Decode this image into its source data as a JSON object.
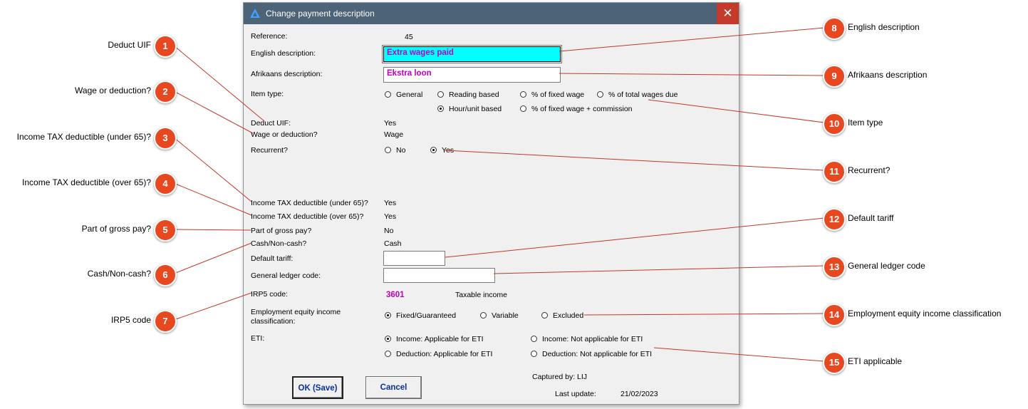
{
  "dialog": {
    "title": "Change payment description",
    "close_glyph": "✕",
    "fields": {
      "reference_label": "Reference:",
      "reference_value": "45",
      "english_label": "English description:",
      "english_value": "Extra wages paid",
      "afrikaans_label": "Afrikaans description:",
      "afrikaans_value": "Ekstra loon",
      "item_type_label": "Item type:",
      "item_type_options": [
        "General",
        "Reading based",
        "% of fixed wage",
        "% of total wages due",
        "Hour/unit based",
        "% of fixed wage + commission"
      ],
      "item_type_selected": "Hour/unit based",
      "deduct_uif_label": "Deduct UIF:",
      "deduct_uif_value": "Yes",
      "wage_deduction_label": "Wage or deduction?",
      "wage_deduction_value": "Wage",
      "recurrent_label": "Recurrent?",
      "recurrent_options": [
        "No",
        "Yes"
      ],
      "recurrent_selected": "Yes",
      "tax_under_label": "Income TAX deductible (under 65)?",
      "tax_under_value": "Yes",
      "tax_over_label": "Income TAX deductible (over 65)?",
      "tax_over_value": "Yes",
      "gross_label": "Part of gross pay?",
      "gross_value": "No",
      "cash_label": "Cash/Non-cash?",
      "cash_value": "Cash",
      "tariff_label": "Default tariff:",
      "tariff_value": "",
      "gl_label": "General ledger code:",
      "gl_value": "",
      "irp5_label": "IRP5 code:",
      "irp5_value": "3601",
      "irp5_desc": "Taxable income",
      "ee_label_1": "Employment equity income",
      "ee_label_2": "classification:",
      "ee_options": [
        "Fixed/Guaranteed",
        "Variable",
        "Excluded"
      ],
      "ee_selected": "Fixed/Guaranteed",
      "eti_label": "ETI:",
      "eti_options": [
        "Income: Applicable for ETI",
        "Income: Not applicable for ETI",
        "Deduction: Applicable for ETI",
        "Deduction: Not applicable for ETI"
      ],
      "eti_selected": "Income: Applicable for ETI",
      "captured_by": "Captured by: LIJ",
      "last_update_label": "Last update:",
      "last_update_value": "21/02/2023"
    },
    "buttons": {
      "ok": "OK (Save)",
      "cancel": "Cancel"
    }
  },
  "callouts": [
    {
      "num": "1",
      "text": "Deduct UIF"
    },
    {
      "num": "2",
      "text": "Wage or deduction?"
    },
    {
      "num": "3",
      "text": "Income TAX deductible (under 65)?"
    },
    {
      "num": "4",
      "text": "Income TAX deductible (over 65)?"
    },
    {
      "num": "5",
      "text": "Part of gross pay?"
    },
    {
      "num": "6",
      "text": "Cash/Non-cash?"
    },
    {
      "num": "7",
      "text": "IRP5 code"
    },
    {
      "num": "8",
      "text": "English description"
    },
    {
      "num": "9",
      "text": "Afrikaans description"
    },
    {
      "num": "10",
      "text": "Item type"
    },
    {
      "num": "11",
      "text": "Recurrent?"
    },
    {
      "num": "12",
      "text": "Default tariff"
    },
    {
      "num": "13",
      "text": "General ledger code"
    },
    {
      "num": "14",
      "text": "Employment equity income classification"
    },
    {
      "num": "15",
      "text": "ETI applicable"
    }
  ],
  "colors": {
    "titlebar": "#4d6377",
    "close": "#c43b2b",
    "badge": "#e8481f",
    "leader": "#c0392b",
    "highlight": "#00ffff",
    "magenta_text": "#c000c0"
  },
  "icons": {
    "app": "app-logo-icon",
    "close": "close-icon"
  }
}
